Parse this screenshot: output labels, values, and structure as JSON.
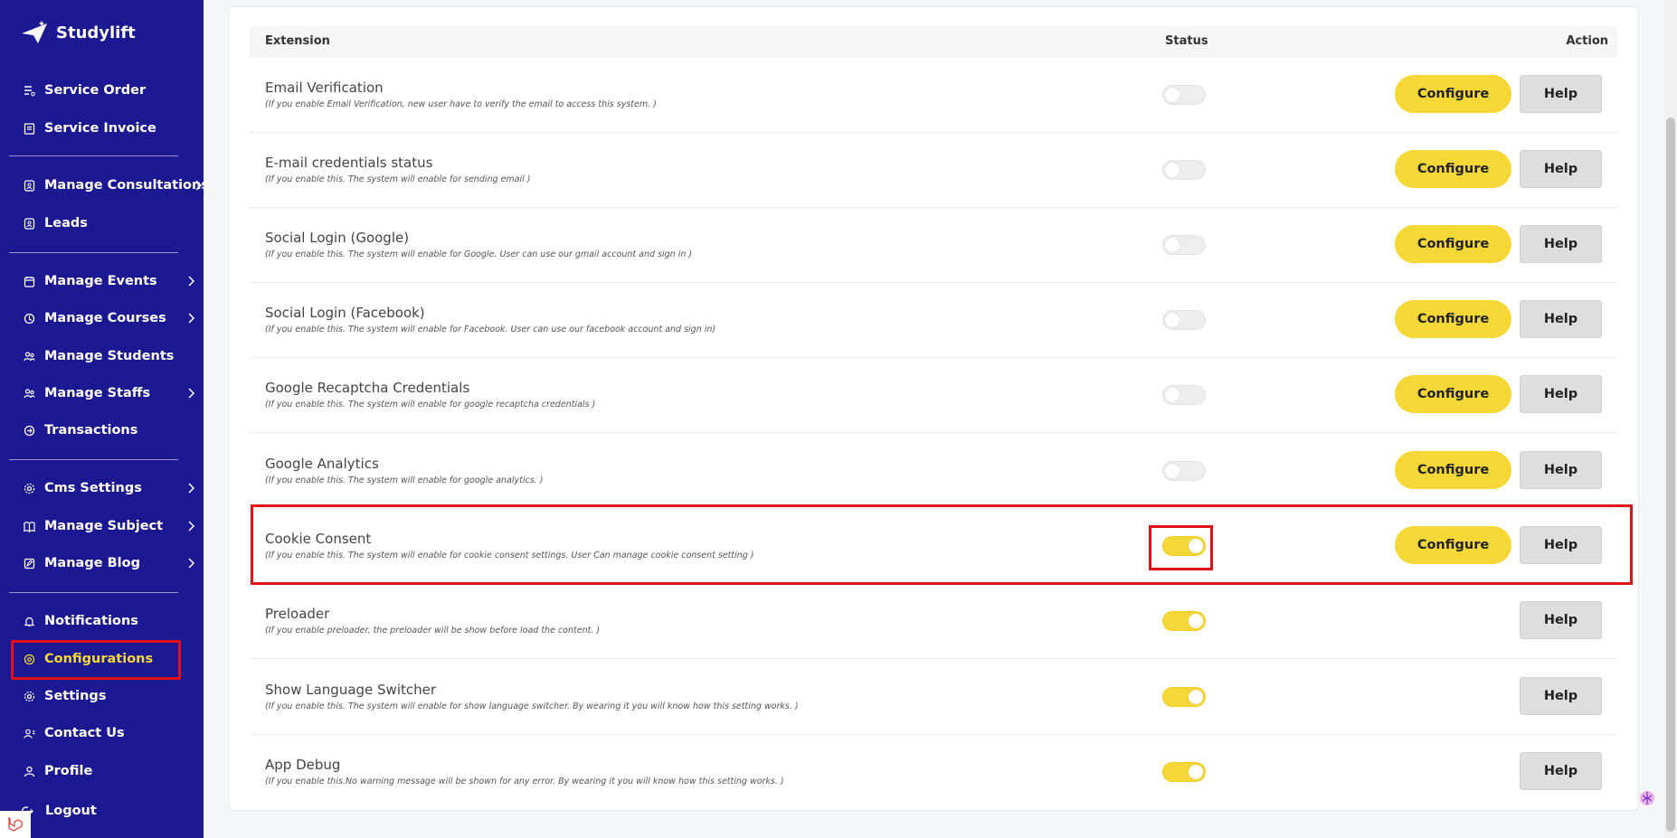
{
  "app": {
    "name": "Studylift"
  },
  "sidebar": {
    "items": [
      {
        "label": "Service Order",
        "icon": "clipboard-list-icon"
      },
      {
        "label": "Service Invoice",
        "icon": "receipt-icon"
      },
      {
        "label": "Manage Consultations",
        "icon": "briefcase-icon",
        "has_submenu": true
      },
      {
        "label": "Leads",
        "icon": "target-icon"
      },
      {
        "label": "Manage Events",
        "icon": "calendar-icon",
        "has_submenu": true
      },
      {
        "label": "Manage Courses",
        "icon": "book-icon",
        "has_submenu": true
      },
      {
        "label": "Manage Students",
        "icon": "users-icon"
      },
      {
        "label": "Manage Staffs",
        "icon": "user-group-icon",
        "has_submenu": true
      },
      {
        "label": "Transactions",
        "icon": "exchange-icon"
      },
      {
        "label": "Cms Settings",
        "icon": "gear-icon",
        "has_submenu": true
      },
      {
        "label": "Manage Subject",
        "icon": "book-open-icon",
        "has_submenu": true
      },
      {
        "label": "Manage Blog",
        "icon": "edit-icon",
        "has_submenu": true
      },
      {
        "label": "Notifications",
        "icon": "bell-icon"
      },
      {
        "label": "Configurations",
        "icon": "settings-sliders-icon",
        "active": true
      },
      {
        "label": "Settings",
        "icon": "cog-icon"
      },
      {
        "label": "Contact Us",
        "icon": "contact-icon"
      },
      {
        "label": "Profile",
        "icon": "user-icon"
      },
      {
        "label": "Logout",
        "icon": "logout-icon"
      }
    ]
  },
  "table": {
    "headers": {
      "extension": "Extension",
      "status": "Status",
      "action": "Action"
    },
    "configure_label": "Configure",
    "help_label": "Help",
    "rows": [
      {
        "title": "Email Verification",
        "description": "(If you enable Email Verification, new user have to verify the email to access this system. )",
        "enabled": false,
        "has_configure": true
      },
      {
        "title": "E-mail credentials status",
        "description": "(If you enable this. The system will enable for sending email )",
        "enabled": false,
        "has_configure": true
      },
      {
        "title": "Social Login (Google)",
        "description": "(If you enable this. The system will enable for Google. User can use our gmail account and sign in )",
        "enabled": false,
        "has_configure": true
      },
      {
        "title": "Social Login (Facebook)",
        "description": "(If you enable this. The system will enable for Facebook. User can use our facebook account and sign in)",
        "enabled": false,
        "has_configure": true
      },
      {
        "title": "Google Recaptcha Credentials",
        "description": "(If you enable this. The system will enable for google recaptcha credentials )",
        "enabled": false,
        "has_configure": true
      },
      {
        "title": "Google Analytics",
        "description": "(If you enable this. The system will enable for google analytics. )",
        "enabled": false,
        "has_configure": true
      },
      {
        "title": "Cookie Consent",
        "description": "(If you enable this. The system will enable for cookie consent settings. User Can manage cookie consent setting )",
        "enabled": true,
        "has_configure": true
      },
      {
        "title": "Preloader",
        "description": "(If you enable preloader, the preloader will be show before load the content. )",
        "enabled": true,
        "has_configure": false
      },
      {
        "title": "Show Language Switcher",
        "description": "(If you enable this. The system will enable for show language switcher. By wearing it you will know how this setting works. )",
        "enabled": true,
        "has_configure": false
      },
      {
        "title": "App Debug",
        "description": "(If you enable this.No warning message will be shown for any error. By wearing it you will know how this setting works. )",
        "enabled": true,
        "has_configure": false
      }
    ]
  },
  "colors": {
    "sidebar_bg": "#1b1891",
    "accent_yellow": "#f5d837",
    "highlight_red": "#e3101a"
  }
}
